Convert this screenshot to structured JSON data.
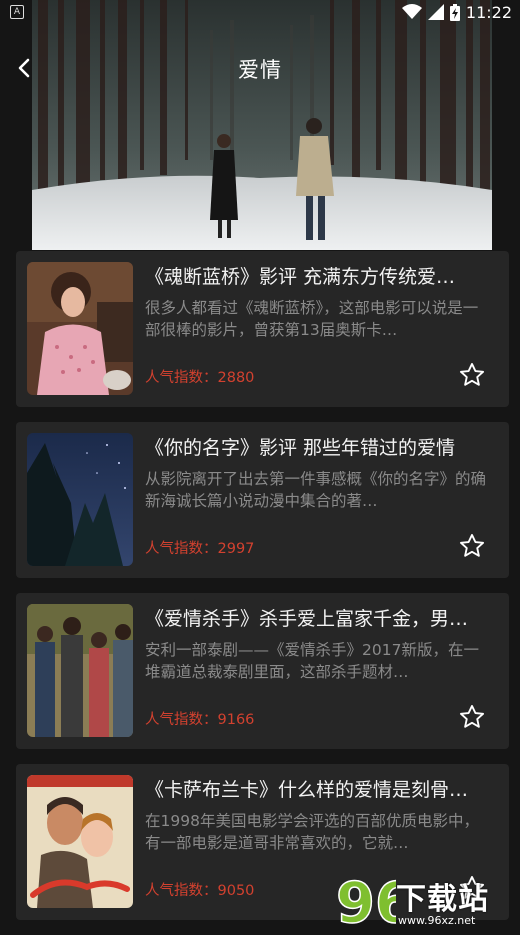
{
  "status_bar": {
    "notification_icon": "A",
    "time": "11:22"
  },
  "header": {
    "title": "爱情",
    "back_icon": "chevron-left-icon"
  },
  "articles": [
    {
      "title": "《魂断蓝桥》影评 充满东方传统爱…",
      "description": "很多人都看过《魂断蓝桥》，这部电影可以说是一部很棒的影片，曾获第13届奥斯卡…",
      "popularity": "人气指数：2880"
    },
    {
      "title": "《你的名字》影评 那些年错过的爱情",
      "description": "从影院离开了出去第一件事感概《你的名字》的确新海诚长篇小说动漫中集合的著…",
      "popularity": "人气指数：2997"
    },
    {
      "title": "《爱情杀手》杀手爱上富家千金，男…",
      "description": "安利一部泰剧——《爱情杀手》2017新版，在一堆霸道总裁泰剧里面，这部杀手题材…",
      "popularity": "人气指数：9166"
    },
    {
      "title": "《卡萨布兰卡》什么样的爱情是刻骨…",
      "description": "在1998年美国电影学会评选的百部优质电影中，有一部电影是道哥非常喜欢的，它就…",
      "popularity": "人气指数：9050"
    }
  ],
  "watermark": {
    "number": "96",
    "text": "下载站",
    "url": "www.96xz.net"
  },
  "colors": {
    "background": "#151515",
    "card": "#262626",
    "popularity": "#d2412f",
    "muted_text": "#8a8a8a"
  }
}
